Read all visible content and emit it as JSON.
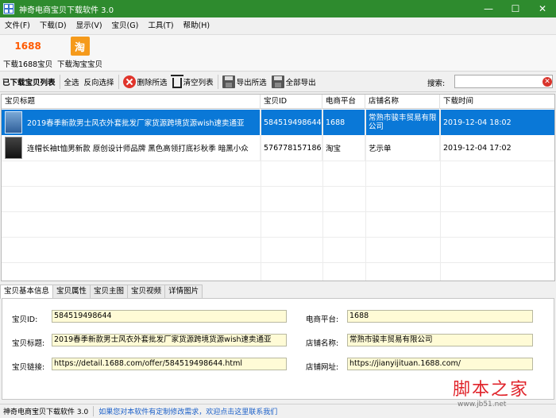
{
  "window": {
    "title": "神奇电商宝贝下载软件 3.0",
    "controls": {
      "minimize": "—",
      "maximize": "☐",
      "close": "✕"
    }
  },
  "menu": [
    "文件(F)",
    "下载(D)",
    "显示(V)",
    "宝贝(G)",
    "工具(T)",
    "帮助(H)"
  ],
  "big_buttons": {
    "download_1688": {
      "logo": "1688",
      "label": "下载1688宝贝"
    },
    "download_taobao": {
      "logo": "淘",
      "label": "下载淘宝宝贝"
    }
  },
  "toolbar": {
    "list_title": "已下载宝贝列表",
    "select_all": "全选",
    "invert_select": "反向选择",
    "delete_selected": "删除所选",
    "clear_list": "清空列表",
    "export_selected": "导出所选",
    "export_all": "全部导出",
    "search_label": "搜索:",
    "search_value": ""
  },
  "table": {
    "columns": [
      "宝贝标题",
      "宝贝ID",
      "电商平台",
      "店铺名称",
      "下载时间"
    ],
    "rows": [
      {
        "title": "2019春季新款男士风衣外套批发厂家货源跨境货源wish速卖通亚",
        "id": "584519498644",
        "platform": "1688",
        "shop": "常熟市骏丰贸易有限公司",
        "time": "2019-12-04 18:02",
        "selected": true
      },
      {
        "title": "连帽长袖t恤男新款 原创设计师品牌 黑色高领打底衫秋季 暗黑小众",
        "id": "576778157186",
        "platform": "淘宝",
        "shop": "艺示单",
        "time": "2019-12-04 17:02",
        "selected": false
      }
    ]
  },
  "tabs": [
    "宝贝基本信息",
    "宝贝属性",
    "宝贝主图",
    "宝贝视频",
    "详情图片"
  ],
  "details": {
    "id_label": "宝贝ID:",
    "id_value": "584519498644",
    "platform_label": "电商平台:",
    "platform_value": "1688",
    "title_label": "宝贝标题:",
    "title_value": "2019春季新款男士风衣外套批发厂家货源跨境货源wish速卖通亚",
    "shop_label": "店铺名称:",
    "shop_value": "常熟市骏丰贸易有限公司",
    "link_label": "宝贝链接:",
    "link_value": "https://detail.1688.com/offer/584519498644.html",
    "shop_url_label": "店铺网址:",
    "shop_url_value": "https://jianyijituan.1688.com/"
  },
  "status": {
    "app": "神奇电商宝贝下载软件 3.0",
    "message": "如果您对本软件有定制修改需求，欢迎点击这里联系我们"
  },
  "watermark": {
    "text": "脚本之家",
    "url": "www.jb51.net"
  },
  "colors": {
    "titlebar": "#2e8b2e",
    "selection": "#0a78d7",
    "field_bg": "#fffbd6",
    "link": "#1a5fc8",
    "watermark": "#e0242b"
  }
}
